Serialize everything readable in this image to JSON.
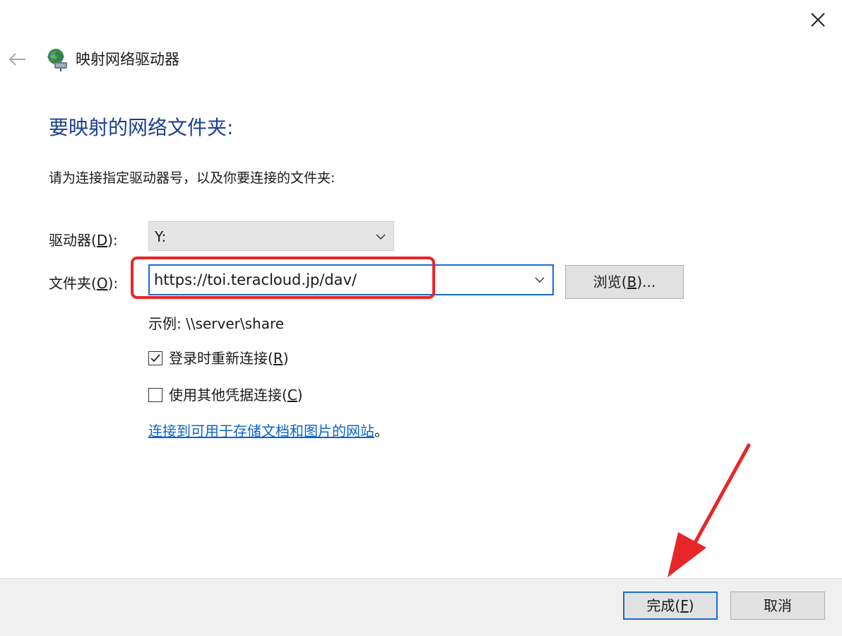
{
  "window": {
    "title": "映射网络驱动器",
    "close_icon": "close-icon",
    "back_icon": "back-arrow-icon",
    "app_icon": "network-drive-icon"
  },
  "main": {
    "heading": "要映射的网络文件夹:",
    "instruction": "请为连接指定驱动器号，以及你要连接的文件夹:",
    "drive": {
      "label": "驱动器(",
      "access_key": "D",
      "label_end": "):",
      "value": "Y:"
    },
    "folder": {
      "label": "文件夹(",
      "access_key": "O",
      "label_end": "):",
      "value": "https://toi.teracloud.jp/dav/"
    },
    "browse": {
      "label": "浏览(",
      "access_key": "B",
      "label_end": ")..."
    },
    "example": "示例: \\\\server\\share",
    "reconnect": {
      "label": "登录时重新连接(",
      "access_key": "R",
      "label_end": ")",
      "checked": true
    },
    "other_credentials": {
      "label": "使用其他凭据连接(",
      "access_key": "C",
      "label_end": ")",
      "checked": false
    },
    "link": {
      "text": "连接到可用于存储文档和图片的网站",
      "suffix": "。"
    }
  },
  "footer": {
    "finish": {
      "label": "完成(",
      "access_key": "F",
      "label_end": ")"
    },
    "cancel": {
      "label": "取消"
    }
  },
  "colors": {
    "heading": "#1e3f8f",
    "accent_border": "#1a6dd0",
    "link": "#0a64c8",
    "annotation_red": "#e8262a",
    "footer_bg": "#f0f0f0"
  }
}
